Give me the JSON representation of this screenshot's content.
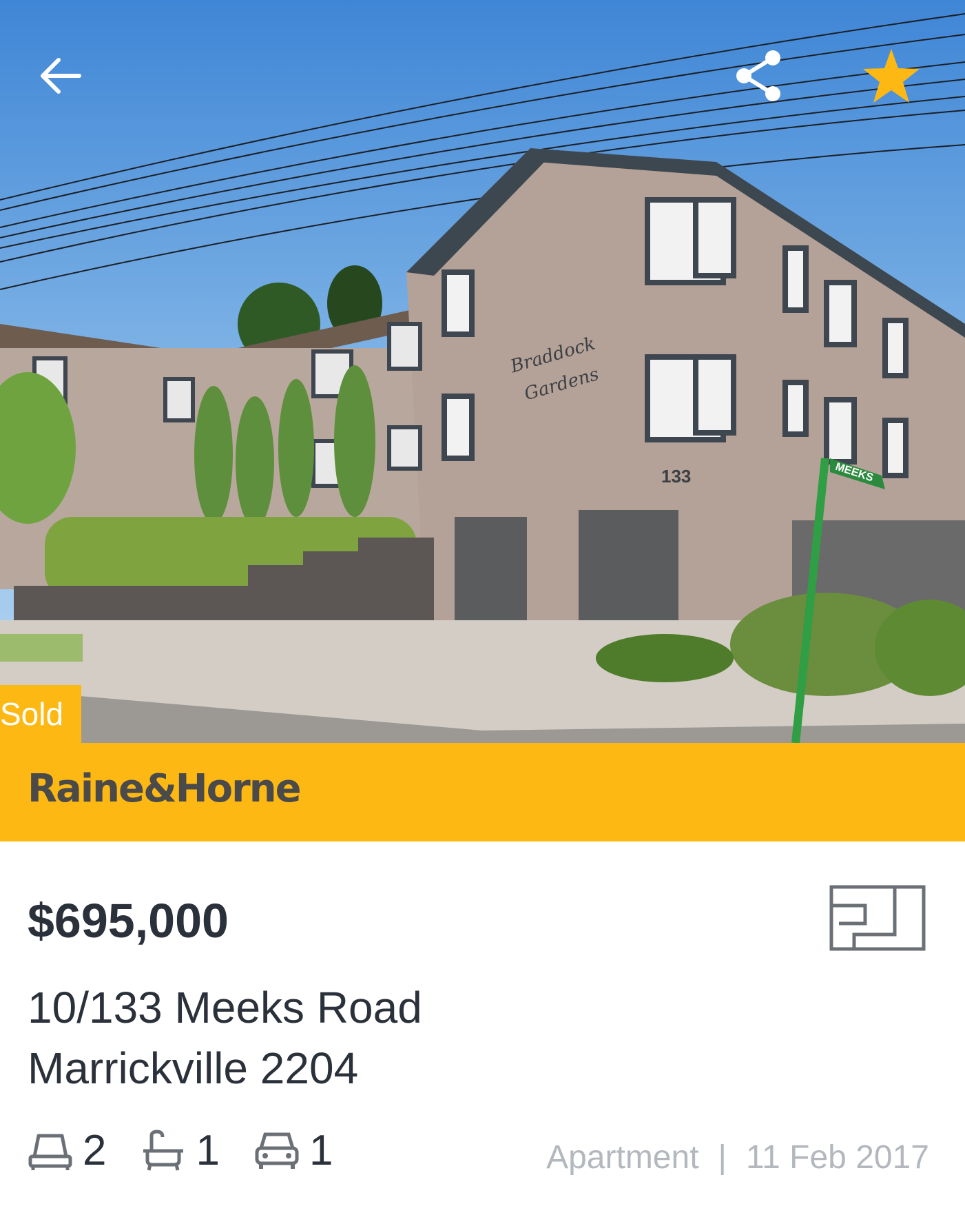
{
  "hero": {
    "back_icon": "arrow-left-icon",
    "share_icon": "share-icon",
    "favorite_icon": "star-icon",
    "favorite_color": "#fdb813",
    "status_badge": "Sold",
    "photo_sign_line1": "Braddock",
    "photo_sign_line2": "Gardens",
    "photo_street_number": "133",
    "photo_street_sign": "MEEKS"
  },
  "agency": {
    "name": "Raine&Horne",
    "brand_color": "#fdb813"
  },
  "listing": {
    "price": "$695,000",
    "address_line1": "10/133 Meeks Road",
    "address_line2": "Marrickville 2204",
    "floorplan_icon": "floorplan-icon",
    "features": {
      "bedrooms": "2",
      "bathrooms": "1",
      "parking": "1"
    },
    "property_type": "Apartment",
    "separator": "|",
    "date": "11 Feb 2017"
  }
}
